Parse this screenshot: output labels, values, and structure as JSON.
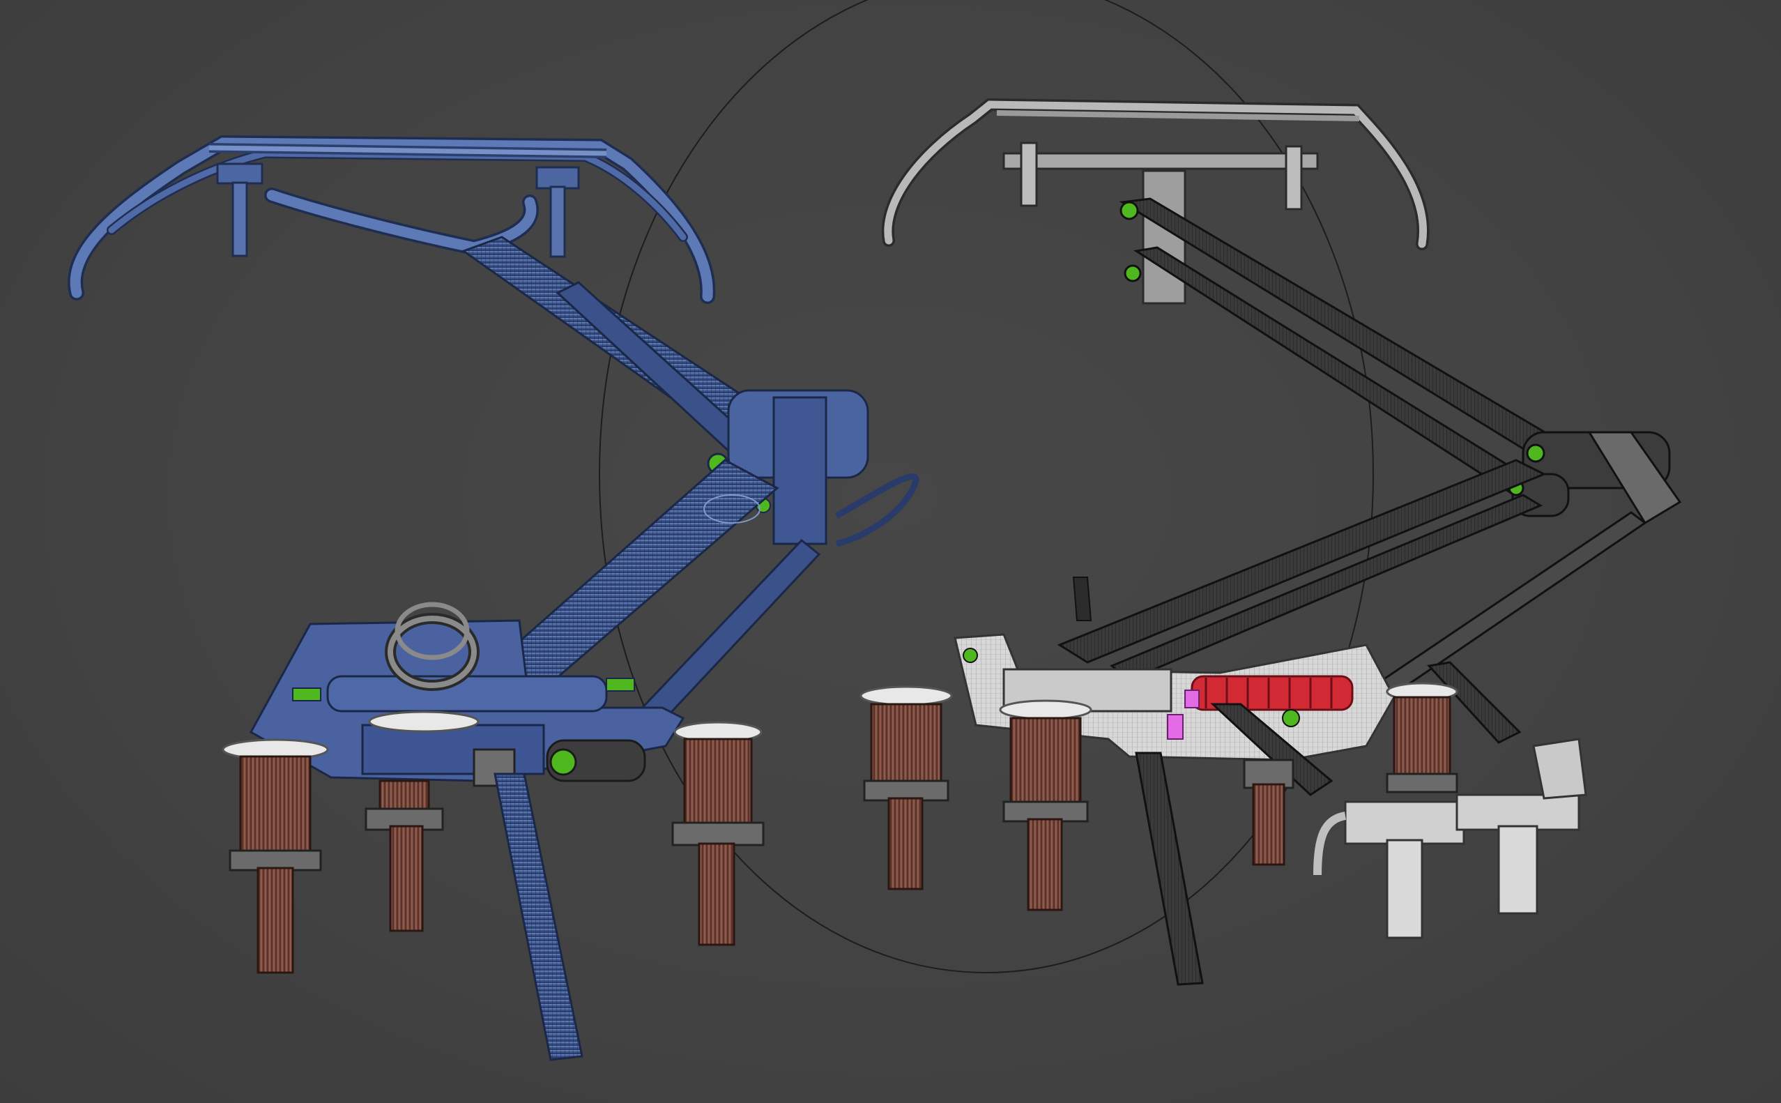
{
  "viewport": {
    "background": "#414141",
    "colors": {
      "blue_shaded": "#3d5690",
      "blue_light": "#5873ad",
      "blue_dark": "#243a6a",
      "wire_dark": "#262626",
      "gray_light": "#d8d8d8",
      "gray_mid": "#a9a9a9",
      "gray_dark": "#4a4a4a",
      "insulator_brown": "#7a4a3c",
      "insulator_white": "#e8e8e8",
      "pin_green": "#4fb81e",
      "spring_red": "#d22a35",
      "magenta_part": "#e46be6",
      "gizmo_circle": "#1d1d1d"
    }
  },
  "models": [
    {
      "name": "pantograph-blue-shaded-wireframe"
    },
    {
      "name": "pantograph-gray-wireframe"
    }
  ]
}
